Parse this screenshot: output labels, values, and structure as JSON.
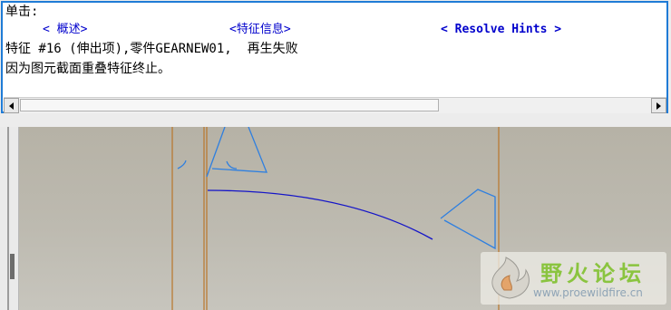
{
  "message": {
    "heading": "单击:",
    "links": {
      "overview": "< 概述>",
      "feature_info": "<特征信息>",
      "resolve_hints": "< Resolve Hints >"
    },
    "line1": "特征 #16 (伸出项),零件GEARNEW01,  再生失败",
    "line2": "因为图元截面重叠特征终止。"
  },
  "scrollbar": {
    "left_arrow": "left-arrow-icon",
    "right_arrow": "right-arrow-icon"
  },
  "watermark": {
    "title": "野火论坛",
    "url": "www.proewildfire.cn"
  },
  "colors": {
    "frame": "#1f7bd6",
    "link": "#0000cc",
    "sketch": "#2e7fe0",
    "arc": "#1414c8",
    "guide": "#b9762a",
    "background": "#bab6ab"
  }
}
